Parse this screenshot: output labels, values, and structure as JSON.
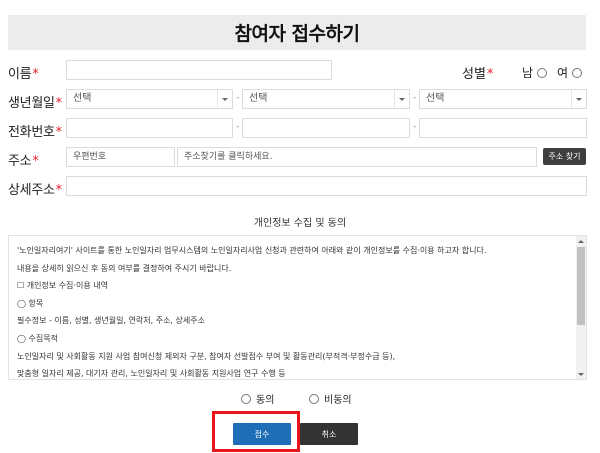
{
  "page_title": "참여자 접수하기",
  "required_mark": "*",
  "form": {
    "name": {
      "label": "이름",
      "value": ""
    },
    "gender": {
      "label": "성별",
      "options": [
        "남",
        "여"
      ]
    },
    "birth": {
      "label": "생년월일",
      "selects": [
        "선택",
        "선택",
        "선택"
      ],
      "separator": "-"
    },
    "phone": {
      "label": "전화번호",
      "separator": "-"
    },
    "address": {
      "label": "주소",
      "zip_placeholder": "우편번호",
      "addr_placeholder": "주소찾기를 클릭하세요.",
      "search_button": "주소 찾기"
    },
    "detail_address": {
      "label": "상세주소"
    }
  },
  "privacy": {
    "title": "개인정보 수집 및 동의",
    "lines": [
      "'노인일자리여기' 사이트를 통한 노인일자리 업무시스템의 노인일자리사업 신청과 관련하여 아래와 같이 개인정보를 수집·이용 하고자 합니다.",
      "내용을 상세히 읽으신 후 동의 여부를 결정하여 주시기 바랍니다.",
      "☐ 개인정보 수집·이용 내역",
      "◯ 항목",
      "필수정보 - 이름, 성별, 생년월일, 연락처, 주소, 상세주소",
      "◯ 수집목적",
      "노인일자리 및 사회활동 지원 사업 참여신청 제외자 구분, 참여자 선발점수 부여 및 활동관리(부적격·부정수급 등),",
      "맞춤형 일자리 제공, 대기자 관리, 노인일자리 및 사회활동 지원사업 연구 수행 등"
    ],
    "agree_label": "동의",
    "disagree_label": "비동의"
  },
  "buttons": {
    "submit": "접수",
    "cancel": "취소"
  },
  "colors": {
    "required": "#e0202c",
    "submit_bg": "#1e6db7",
    "cancel_bg": "#333333",
    "highlight": "#e8141c",
    "title_bg": "#ececec"
  }
}
